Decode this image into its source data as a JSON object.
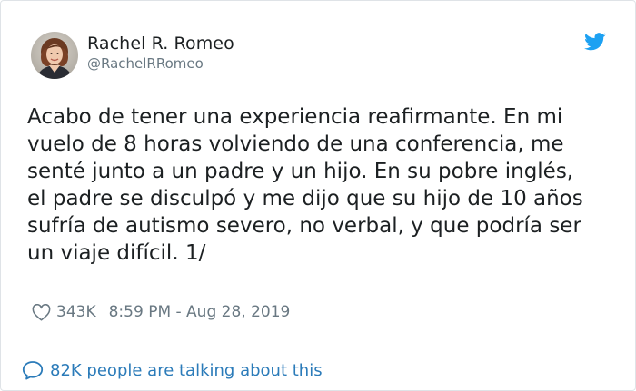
{
  "author": {
    "display_name": "Rachel R. Romeo",
    "handle": "@RachelRRomeo",
    "avatar_icon": "profile-photo"
  },
  "brand_icon": "twitter-bird-icon",
  "tweet": {
    "lines": [
      "Acabo de tener una experiencia reafirmante. En mi",
      "vuelo de 8 horas volviendo de una conferencia, me",
      "senté junto a un padre y un hijo. En su pobre inglés,",
      "el padre se disculpó y me dijo que su hijo de 10 años",
      "sufría de autismo severo, no verbal, y que podría ser",
      "un viaje difícil. 1/"
    ]
  },
  "meta": {
    "likes": "343K",
    "timestamp": "8:59 PM - Aug 28, 2019"
  },
  "conversation": {
    "label": "82K people are talking about this"
  },
  "colors": {
    "twitter_blue": "#1da1f2",
    "link_blue": "#2b7bb9",
    "muted_gray": "#697882",
    "text_dark": "#1c2022",
    "border": "#e6ecf0"
  }
}
